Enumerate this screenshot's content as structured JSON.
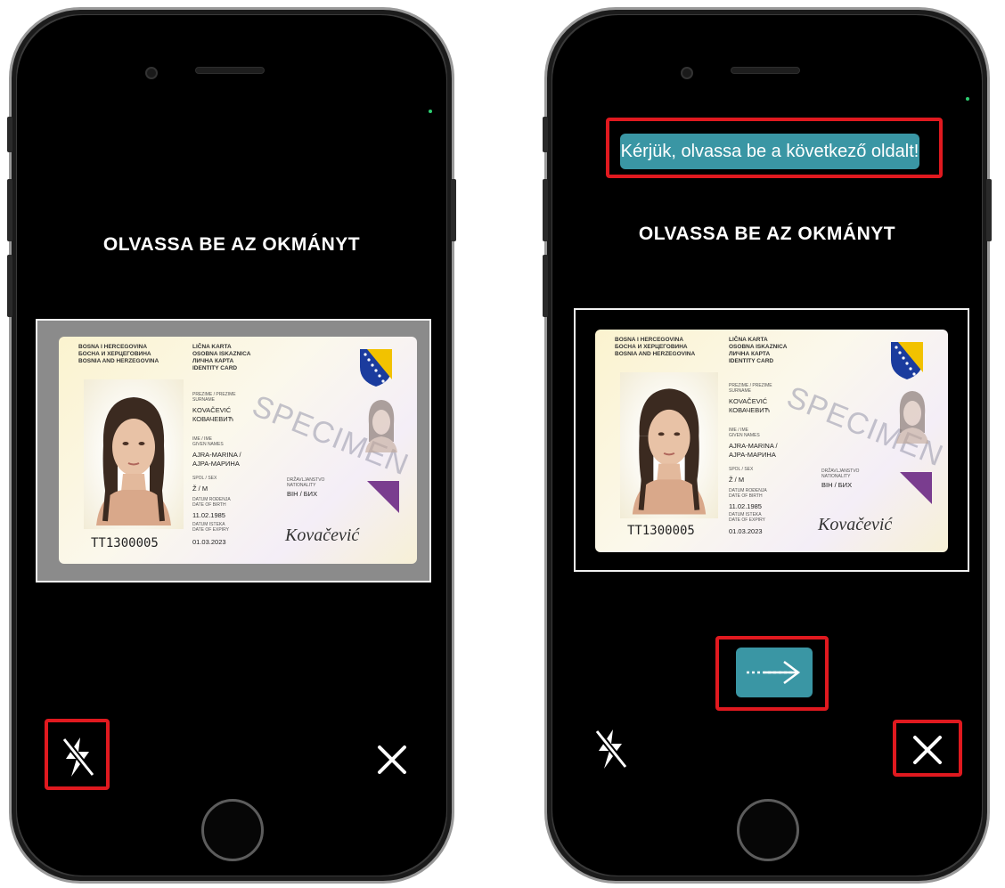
{
  "screens": [
    {
      "title": "OLVASSA BE AZ OKMÁNYT",
      "flash_icon": "flash-off-icon",
      "close_icon": "close-icon",
      "highlighted": [
        "flash-button"
      ]
    },
    {
      "notice": "Kérjük, olvassa be a következő oldalt!",
      "title": "OLVASSA BE AZ OKMÁNYT",
      "next_icon": "arrow-right-icon",
      "flash_icon": "flash-off-icon",
      "close_icon": "close-icon",
      "highlighted": [
        "notice-banner",
        "next-button",
        "close-button"
      ]
    }
  ],
  "id_card": {
    "country_header": "BOSNA I HERCEGOVINA\nБОСНА И ХЕРЦЕГОВИНА\nBOSNIA AND HERZEGOVINA",
    "card_header": "LIČNA KARTA\nOSOBNA ISKAZNICA\nЛИЧНА КАРТА\nIDENTITY CARD",
    "surname_label": "PREZIME / PREZIME\nSURNAME",
    "surname": "KOVAČEVIĆ\nКОВАЧЕВИЋ",
    "given_label": "IME / IME\nGIVEN NAMES",
    "given_names": "AJRA-MARINA /\nАЈРА-МАРИНА",
    "sex_label": "SPOL / SEX",
    "sex": "Ž / M",
    "birth_label": "DATUM ROĐENJA\nDATE OF BIRTH",
    "birth_date": "11.02.1985",
    "expiry_label": "DATUM ISTEKA\nDATE OF EXPIRY",
    "expiry_date": "01.03.2023",
    "nationality_label": "DRŽAVLJANSTVO\nNATIONALITY",
    "nationality": "BIH / БИХ",
    "document_no": "TT1300005",
    "watermark": "SPECIMEN",
    "signature": "Kovačević",
    "colors": {
      "flag_blue": "#1b3c9e",
      "flag_yellow": "#f2c200",
      "purple": "#7a3d8f"
    }
  },
  "colors": {
    "highlight": "#e0191f",
    "accent": "#3a96a4"
  }
}
